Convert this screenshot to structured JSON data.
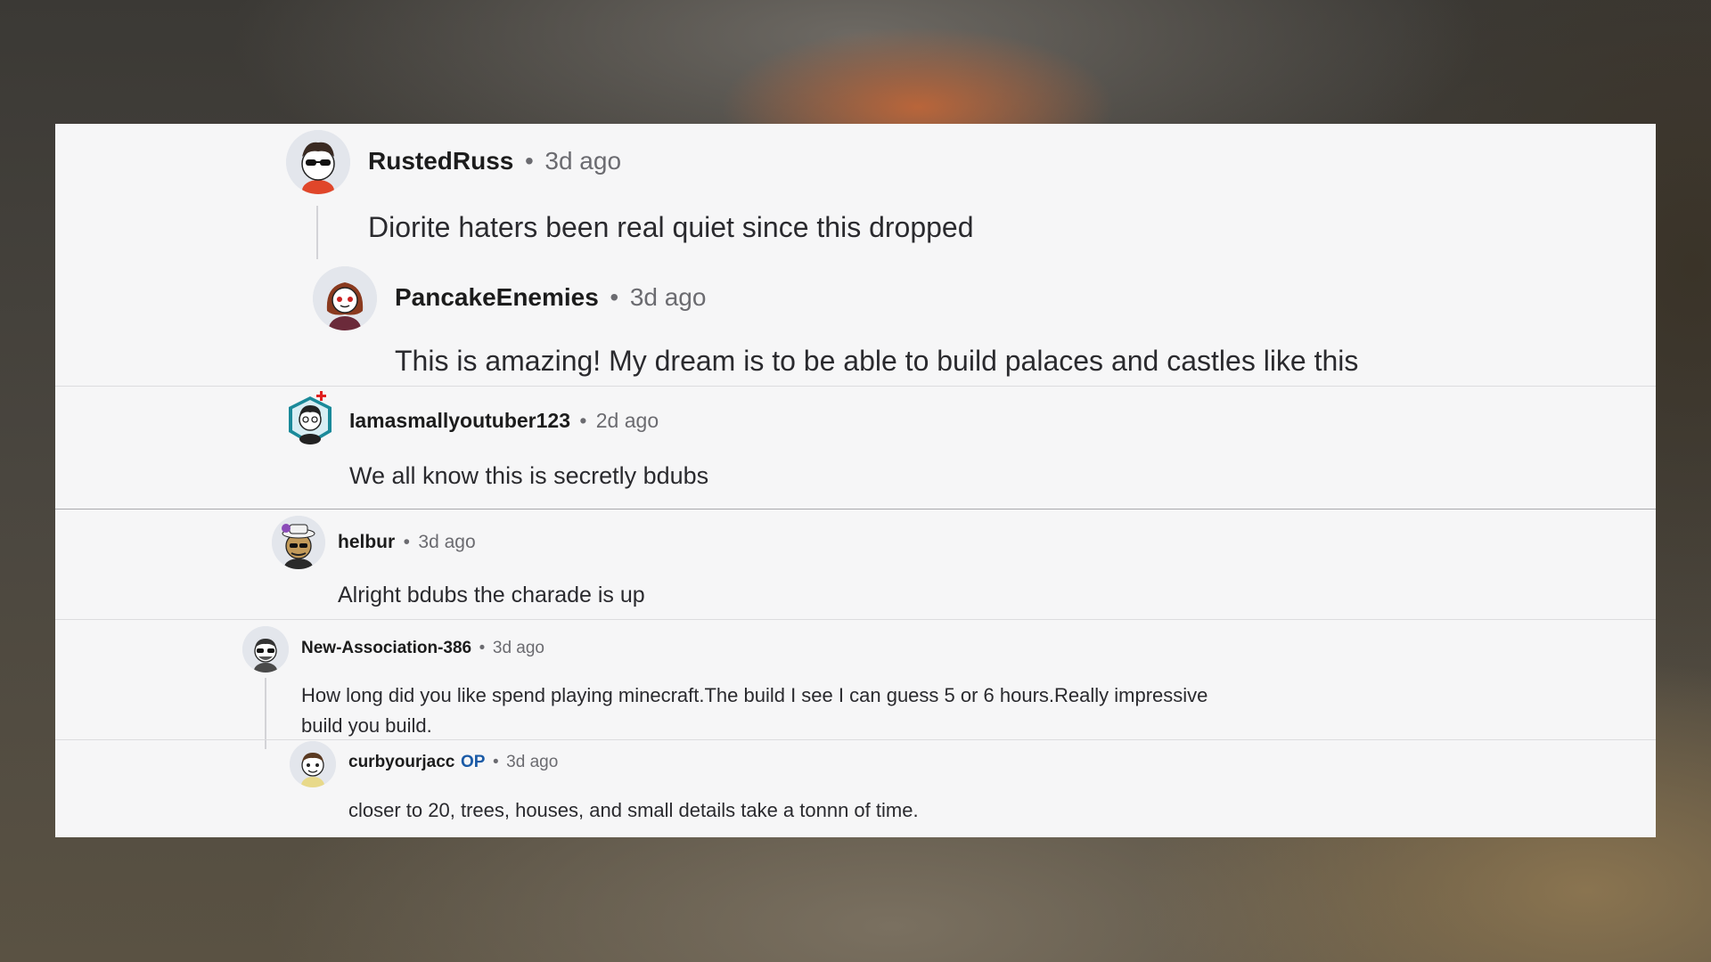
{
  "comments": [
    {
      "username": "RustedRuss",
      "time": "3d ago",
      "text": "Diorite haters been real quiet since this dropped",
      "avatar": "reddit-avatar-sunglasses-icon"
    },
    {
      "username": "PancakeEnemies",
      "time": "3d ago",
      "text": "This is amazing! My dream is to be able to build palaces and castles like this",
      "avatar": "reddit-avatar-red-hair-icon"
    },
    {
      "username": "Iamasmallyoutuber123",
      "time": "2d ago",
      "text": "We all know this is secretly bdubs",
      "avatar": "reddit-avatar-hexagon-nft-icon"
    },
    {
      "username": "helbur",
      "time": "3d ago",
      "text": "Alright bdubs the charade is up",
      "avatar": "reddit-avatar-purple-hat-icon"
    },
    {
      "username": "New-Association-386",
      "time": "3d ago",
      "text_line1": "How long did you like spend playing minecraft.The build I see I can guess 5 or 6 hours.Really impressive",
      "text_line2": "build you build.",
      "avatar": "reddit-avatar-sunglasses-beard-icon"
    },
    {
      "username": "curbyourjacc",
      "badge": "OP",
      "time": "3d ago",
      "text": "closer to 20, trees, houses, and small details take a tonnn of time.",
      "avatar": "reddit-avatar-yellow-shirt-icon"
    }
  ],
  "separator": "•",
  "colors": {
    "panel": "#f6f6f7",
    "username": "#1c1c1c",
    "meta": "#6b6b70",
    "op_badge": "#1a5aa6"
  }
}
